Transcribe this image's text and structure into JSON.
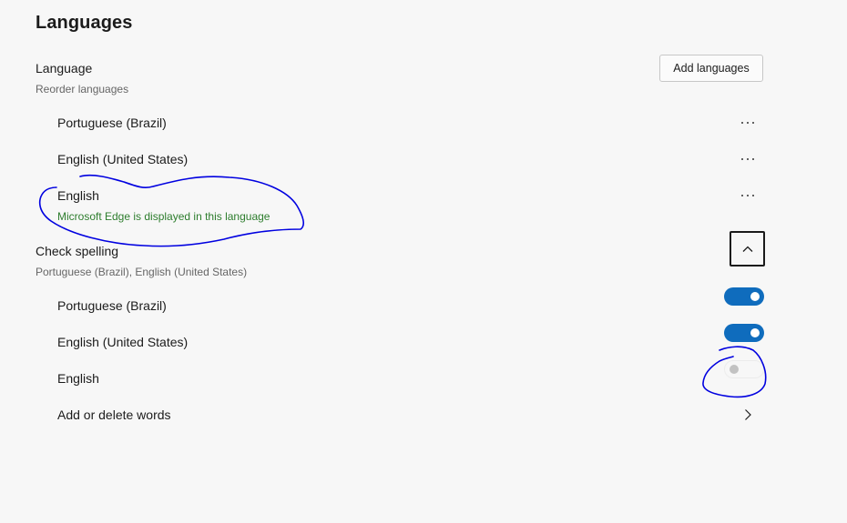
{
  "page": {
    "title": "Languages"
  },
  "language_section": {
    "title": "Language",
    "subtitle": "Reorder languages",
    "add_button_label": "Add languages",
    "items": [
      {
        "label": "Portuguese (Brazil)",
        "more_icon": "more-horizontal-icon"
      },
      {
        "label": "English (United States)",
        "more_icon": "more-horizontal-icon"
      },
      {
        "label": "English",
        "note": "Microsoft Edge is displayed in this language",
        "more_icon": "more-horizontal-icon"
      }
    ]
  },
  "spelling_section": {
    "title": "Check spelling",
    "subtitle": "Portuguese (Brazil), English (United States)",
    "collapse_icon": "chevron-up-icon",
    "items": [
      {
        "label": "Portuguese (Brazil)",
        "enabled": true
      },
      {
        "label": "English (United States)",
        "enabled": true
      },
      {
        "label": "English",
        "enabled": false
      }
    ],
    "add_delete_words_label": "Add or delete words",
    "add_delete_icon": "chevron-right-icon"
  },
  "colors": {
    "accent": "#0f6cbd",
    "note_green": "#2d7d2d",
    "annotation_ink": "#0000e0",
    "background": "#f7f7f7"
  }
}
